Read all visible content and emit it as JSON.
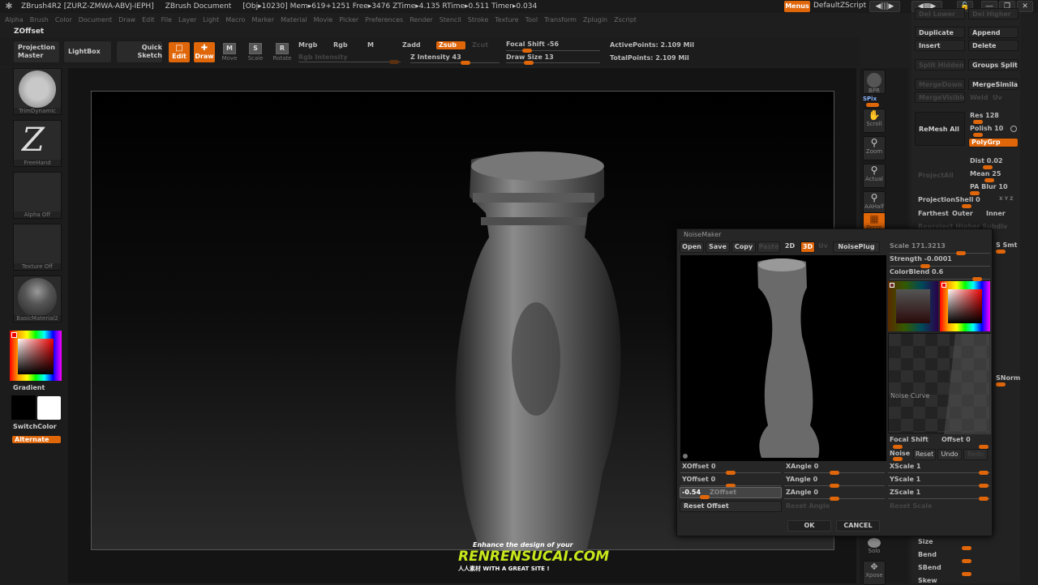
{
  "titlebar": {
    "app": "ZBrush4R2 [ZURZ-ZMWA-ABVJ-IEPH]",
    "document": "ZBrush Document",
    "stats": "[Obj▸10230] Mem▸619+1251 Free▸3476 ZTime▸4.135 RTime▸0.511 Timer▸0.034",
    "menus_button": "Menus",
    "script": "DefaultZScript"
  },
  "menubar": [
    "Alpha",
    "Brush",
    "Color",
    "Document",
    "Draw",
    "Edit",
    "File",
    "Layer",
    "Light",
    "Macro",
    "Marker",
    "Material",
    "Movie",
    "Picker",
    "Preferences",
    "Render",
    "Stencil",
    "Stroke",
    "Texture",
    "Tool",
    "Transform",
    "Zplugin",
    "Zscript"
  ],
  "status_label": "ZOffset",
  "toolbar": {
    "projection_master": "Projection Master",
    "lightbox": "LightBox",
    "quick_sketch": "Quick Sketch",
    "edit": "Edit",
    "draw": "Draw",
    "move": "Move",
    "scale": "Scale",
    "rotate": "Rotate",
    "mrgb": "Mrgb",
    "rgb": "Rgb",
    "m": "M",
    "rgb_intensity": "Rgb Intensity",
    "zadd": "Zadd",
    "zsub": "Zsub",
    "zcut": "Zcut",
    "z_intensity": "Z Intensity 43",
    "focal_shift": "Focal Shift -56",
    "draw_size": "Draw Size 13",
    "active_points": "ActivePoints: 2.109 Mil",
    "total_points": "TotalPoints: 2.109 Mil"
  },
  "leftbar": {
    "brush": "TrimDynamic",
    "stroke": "FreeHand",
    "alpha": "Alpha Off",
    "texture": "Texture Off",
    "material": "BasicMaterial2",
    "gradient": "Gradient",
    "switch_color": "SwitchColor",
    "alternate": "Alternate"
  },
  "shelf": [
    "BPR",
    "SPix",
    "Scroll",
    "Zoom",
    "Actual",
    "AAHalf",
    "Persp",
    "Solo",
    "Xpose"
  ],
  "rpanel": {
    "top_left": "Del Lower",
    "top_right": "Del Higher",
    "duplicate": "Duplicate",
    "append": "Append",
    "insert": "Insert",
    "delete": "Delete",
    "split_hidden": "Split Hidden",
    "groups_split": "Groups Split",
    "merge_down": "MergeDown",
    "merge_similar": "MergeSimilar",
    "merge_visible": "MergeVisible",
    "weld": "Weld",
    "uv": "Uv",
    "remesh_all": "ReMesh All",
    "res": "Res 128",
    "polish": "Polish 10",
    "polygrp": "PolyGrp",
    "project_all": "ProjectAll",
    "dist": "Dist 0.02",
    "mean": "Mean 25",
    "pa_blur": "PA Blur 10",
    "projection_shell": "ProjectionShell 0",
    "xyz": "X Y Z",
    "farthest": "Farthest",
    "outer": "Outer",
    "inner": "Inner",
    "reproject": "Reproject Higher Subdiv",
    "s_smt": "S Smt",
    "snorm": "SNorm",
    "size": "Size",
    "bend": "Bend",
    "sbend": "SBend",
    "skew": "Skew"
  },
  "noisemaker": {
    "title": "NoiseMaker",
    "buttons": {
      "open": "Open",
      "save": "Save",
      "copy": "Copy",
      "paste": "Paste",
      "2d": "2D",
      "3d": "3D",
      "uv": "Uv",
      "noiseplug": "NoisePlug"
    },
    "scale": "Scale 171.3213",
    "strength": "Strength -0.0001",
    "colorblend": "ColorBlend 0.6",
    "noise_curve": "Noise Curve",
    "focal_shift": "Focal Shift",
    "offset": "Offset 0",
    "noise": "Noise",
    "reset": "Reset",
    "undo": "Undo",
    "redo": "Redo",
    "xoffset": "XOffset 0",
    "yoffset": "YOffset 0",
    "zoffset_value": "-0.54",
    "zoffset": "ZOffset",
    "xangle": "XAngle 0",
    "yangle": "YAngle 0",
    "zangle": "ZAngle 0",
    "xscale": "XScale 1",
    "yscale": "YScale 1",
    "zscale": "ZScale 1",
    "reset_offset": "Reset Offset",
    "reset_angle": "Reset Angle",
    "reset_scale": "Reset Scale",
    "ok": "OK",
    "cancel": "CANCEL"
  },
  "watermark": {
    "line1": "Enhance the design of your",
    "line2": "RENRENSUCAI.COM",
    "line3": "人人素材  WITH A GREAT SITE !"
  },
  "colors": {
    "accent": "#e0660a",
    "bg": "#1e1e1e"
  }
}
